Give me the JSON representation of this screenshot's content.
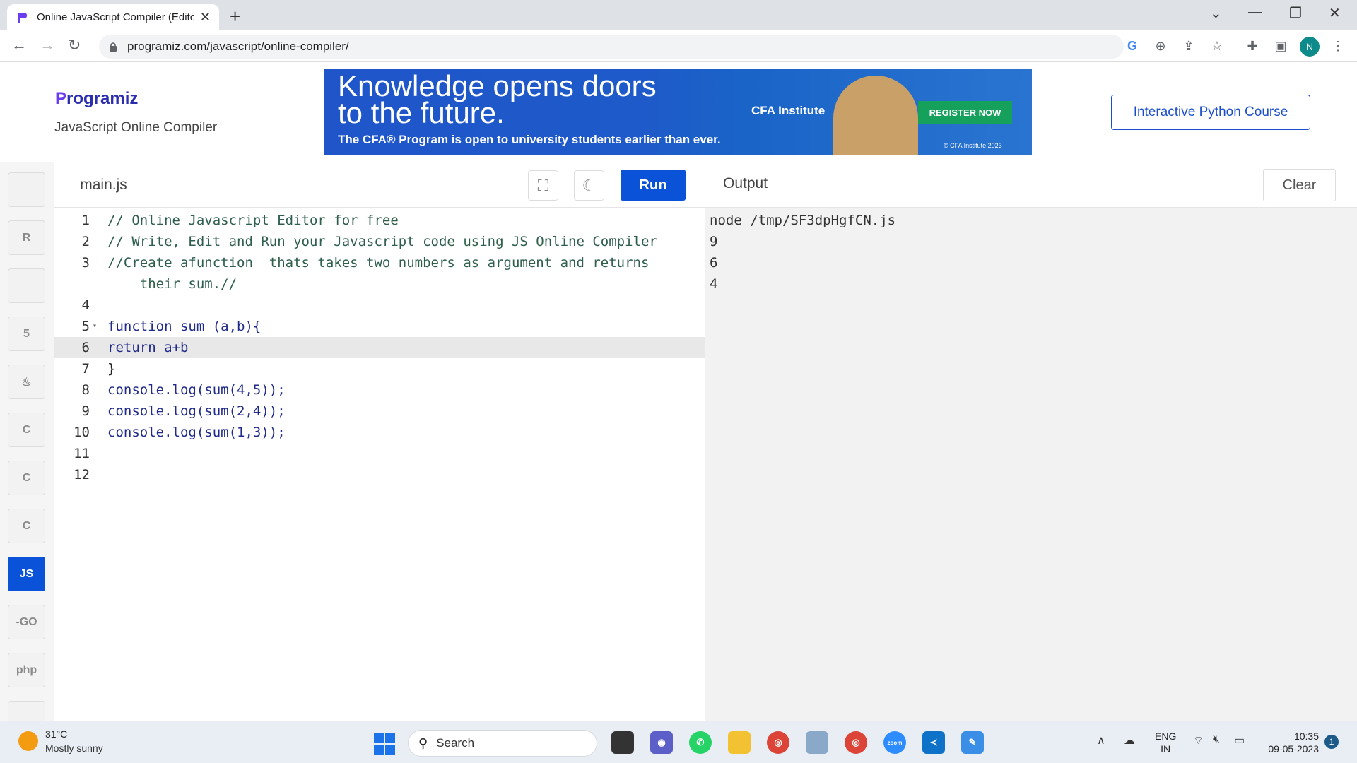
{
  "browser": {
    "tab_title": "Online JavaScript Compiler (Edito",
    "url": "programiz.com/javascript/online-compiler/",
    "profile_initial": "N"
  },
  "header": {
    "logo_text": "rogramiz",
    "logo_p": "P",
    "subtitle": "JavaScript Online Compiler",
    "banner": {
      "headline_1": "Knowledge opens doors",
      "headline_2": "to the future.",
      "subline": "The CFA® Program is open to university students earlier than ever.",
      "brand": "CFA Institute",
      "cta": "REGISTER NOW",
      "copyright": "© CFA Institute 2023"
    },
    "course_button": "Interactive Python Course"
  },
  "sidebar": {
    "languages": [
      {
        "name": "python",
        "glyph": ""
      },
      {
        "name": "r",
        "glyph": "R"
      },
      {
        "name": "sql",
        "glyph": ""
      },
      {
        "name": "html",
        "glyph": "5"
      },
      {
        "name": "java",
        "glyph": "♨"
      },
      {
        "name": "c",
        "glyph": "C"
      },
      {
        "name": "cpp",
        "glyph": "C"
      },
      {
        "name": "csharp",
        "glyph": "C"
      },
      {
        "name": "javascript",
        "glyph": "JS"
      },
      {
        "name": "go",
        "glyph": "-GO"
      },
      {
        "name": "php",
        "glyph": "php"
      },
      {
        "name": "swift",
        "glyph": ""
      }
    ]
  },
  "editor": {
    "filename": "main.js",
    "run_label": "Run",
    "lines": [
      {
        "num": "1",
        "text": "// Online Javascript Editor for free",
        "kind": "comment"
      },
      {
        "num": "2",
        "text": "// Write, Edit and Run your Javascript code using JS Online Compiler",
        "kind": "comment"
      },
      {
        "num": "3",
        "text": "//Create afunction  thats takes two numbers as argument and returns",
        "kind": "comment"
      },
      {
        "num": "",
        "text": "    their sum.//",
        "kind": "comment"
      },
      {
        "num": "4",
        "text": "",
        "kind": "plain"
      },
      {
        "num": "5",
        "text": "function sum (a,b){",
        "kind": "code"
      },
      {
        "num": "6",
        "text": "return a+b",
        "kind": "code"
      },
      {
        "num": "7",
        "text": "}",
        "kind": "plain"
      },
      {
        "num": "8",
        "text": "console.log(sum(4,5));",
        "kind": "code"
      },
      {
        "num": "9",
        "text": "console.log(sum(2,4));",
        "kind": "code"
      },
      {
        "num": "10",
        "text": "console.log(sum(1,3));",
        "kind": "code"
      },
      {
        "num": "11",
        "text": "",
        "kind": "plain"
      },
      {
        "num": "12",
        "text": "",
        "kind": "plain"
      }
    ]
  },
  "output": {
    "title": "Output",
    "clear_label": "Clear",
    "lines": [
      "node /tmp/SF3dpHgfCN.js",
      "9",
      "6",
      "4"
    ]
  },
  "taskbar": {
    "temperature": "31°C",
    "condition": "Mostly sunny",
    "search_label": "Search",
    "lang_1": "ENG",
    "lang_2": "IN",
    "time": "10:35",
    "date": "09-05-2023",
    "notifications": "1"
  }
}
